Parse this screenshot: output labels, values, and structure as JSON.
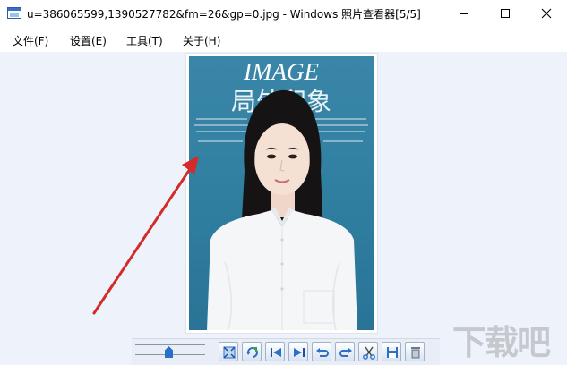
{
  "window": {
    "title": "u=386065599,1390527782&fm=26&gp=0.jpg - Windows 照片查看器[5/5]"
  },
  "menu": {
    "items": [
      {
        "label": "文件(F)"
      },
      {
        "label": "设置(E)"
      },
      {
        "label": "工具(T)"
      },
      {
        "label": "关于(H)"
      }
    ]
  },
  "photo": {
    "title_text": "IMAGE",
    "cn_text": "局外印象",
    "colors": {
      "background": "#2f7ea0",
      "shirt": "#f4f6f7",
      "hair": "#151313"
    }
  },
  "annotation": {
    "arrow_color": "#d42a2a"
  },
  "toolbar": {
    "zoom_level": 0.45,
    "buttons": [
      {
        "icon": "fit-to-window-icon"
      },
      {
        "icon": "refresh-icon"
      },
      {
        "icon": "first-image-icon"
      },
      {
        "icon": "last-image-icon"
      },
      {
        "icon": "rotate-left-icon"
      },
      {
        "icon": "rotate-right-icon"
      },
      {
        "icon": "cut-icon"
      },
      {
        "icon": "save-icon"
      },
      {
        "icon": "delete-icon"
      }
    ]
  },
  "watermark": {
    "text": "下载吧"
  }
}
